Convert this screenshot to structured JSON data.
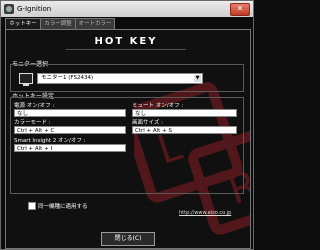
{
  "window": {
    "title": "G-Ignition",
    "close_label": "✕"
  },
  "tabs": [
    {
      "label": "ホットキー",
      "active": true
    },
    {
      "label": "カラー調整",
      "active": false
    },
    {
      "label": "オートカラー",
      "active": false
    }
  ],
  "logo": "HOT KEY",
  "monitor_section": {
    "label": "モニター選択",
    "selected": "モニター1 (FS2434)",
    "dropdown_icon": "chevron-down-icon"
  },
  "hotkey_section": {
    "label": "ホットキー設定",
    "fields": [
      {
        "label": "電源 オン/オフ :",
        "value": "なし"
      },
      {
        "label": "ミュート オン/オフ :",
        "value": "なし"
      },
      {
        "label": "カラーモード :",
        "value": "Ctrl + Alt + C"
      },
      {
        "label": "画面サイズ :",
        "value": "Ctrl + Alt + S"
      },
      {
        "label": "Smart Insight 2 オン/オフ :",
        "value": "Ctrl + Alt + I"
      }
    ]
  },
  "apply_all_label": "同一機種に適用する",
  "url": "http://www.eizo.co.jp",
  "close_button_label": "閉じる(C)",
  "colors": {
    "background": "#0c0c0c",
    "watermark": "#6e1a1f"
  }
}
